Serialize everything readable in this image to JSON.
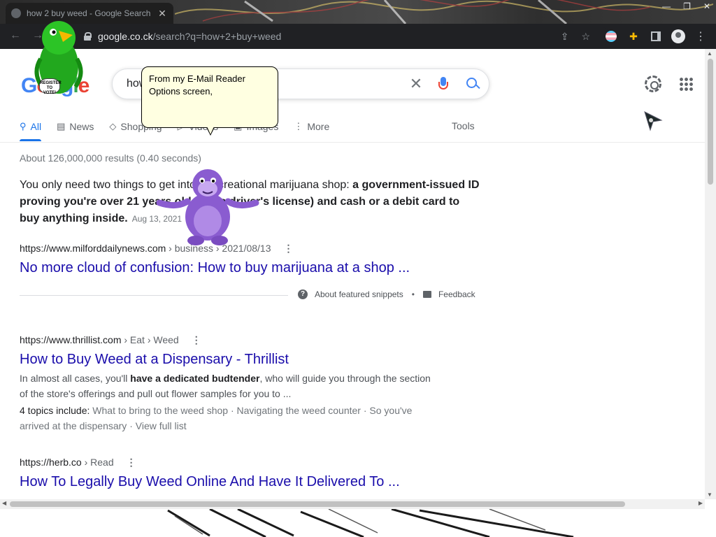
{
  "browser": {
    "tab_title": "how 2 buy weed - Google Search",
    "tab_close": "✕",
    "url_host": "google.co.ck",
    "url_path": "/search?q=how+2+buy+weed"
  },
  "google": {
    "logo_letters": [
      "G",
      "o",
      "o",
      "g",
      "l",
      "e"
    ],
    "query": "how",
    "tabs": [
      {
        "label": "All",
        "icon": "⚲"
      },
      {
        "label": "News",
        "icon": "▤"
      },
      {
        "label": "Shopping",
        "icon": "◇"
      },
      {
        "label": "Videos",
        "icon": "▷"
      },
      {
        "label": "Images",
        "icon": "▣"
      },
      {
        "label": "More",
        "icon": "⋮"
      }
    ],
    "tools": "Tools",
    "stats": "About 126,000,000 results (0.40 seconds)"
  },
  "featured": {
    "text_plain": "You only need two things to get into a recreational marijuana shop: ",
    "text_bold": "a government-issued ID proving you're over 21 years old (like a driver's license) and cash or a debit card to buy anything inside",
    "text_end": ".",
    "date": "Aug 13, 2021",
    "cite_url": "https://www.milforddailynews.com",
    "cite_path": " › business › 2021/08/13",
    "title": "No more cloud of confusion: How to buy marijuana at a shop ...",
    "about": "About featured snippets",
    "sep": "•",
    "feedback": "Feedback"
  },
  "results": [
    {
      "cite_url": "https://www.thrillist.com",
      "cite_path": " › Eat › Weed",
      "title": "How to Buy Weed at a Dispensary - Thrillist",
      "desc_pre": "In almost all cases, you'll ",
      "desc_bold": "have a dedicated budtender",
      "desc_post": ", who will guide you through the section of the store's offerings and pull out flower samples for you to ...",
      "topics_label": "4 topics include: ",
      "topics": "What to bring to the weed shop · Navigating the weed counter · So you've arrived at the dispensary · View full list"
    },
    {
      "cite_url": "https://herb.co",
      "cite_path": " › Read",
      "title": "How To Legally Buy Weed Online And Have It Delivered To ..."
    }
  ],
  "assistant": {
    "balloon_text": "From my E-Mail Reader Options screen,",
    "badge_text": "REGISTER TO VOTE!"
  },
  "colors": {
    "link": "#1a0dab",
    "accent_blue": "#1a73e8",
    "bonzi_purple": "#8a5cd0",
    "parrot_green": "#22a81e",
    "balloon_bg": "#ffffe1"
  }
}
